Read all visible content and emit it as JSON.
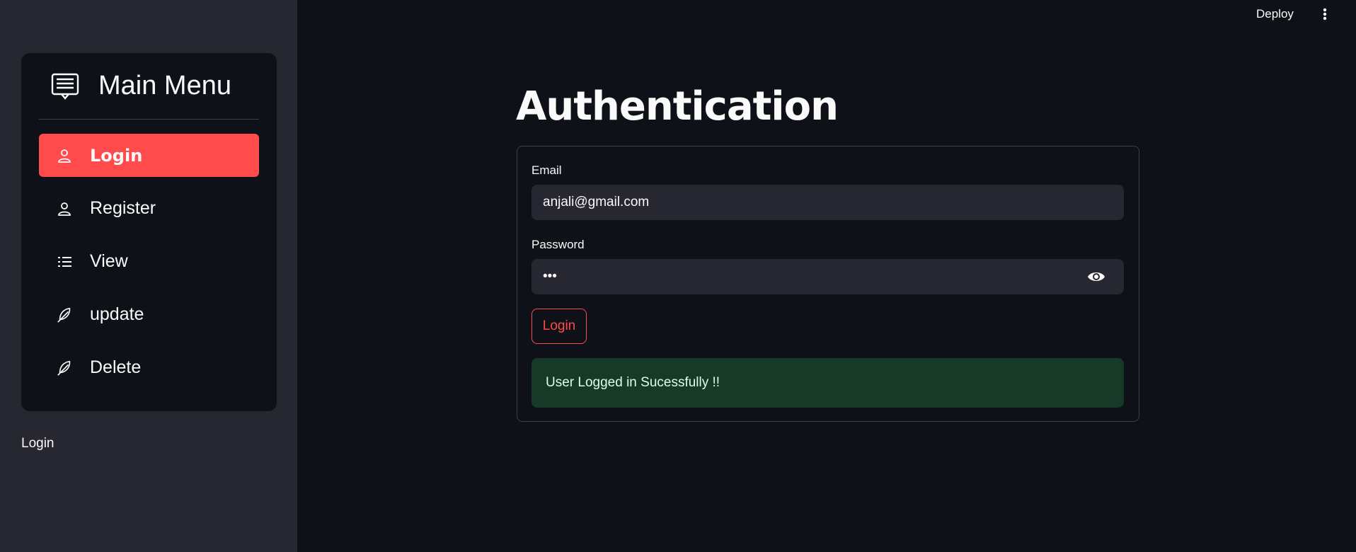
{
  "sidebar": {
    "menu_title": "Main Menu",
    "items": [
      {
        "label": "Login",
        "icon": "person-icon",
        "active": true
      },
      {
        "label": "Register",
        "icon": "person-icon",
        "active": false
      },
      {
        "label": "View",
        "icon": "list-icon",
        "active": false
      },
      {
        "label": "update",
        "icon": "feather-icon",
        "active": false
      },
      {
        "label": "Delete",
        "icon": "feather-icon",
        "active": false
      }
    ],
    "status_text": "Login"
  },
  "topbar": {
    "deploy_label": "Deploy",
    "menu_icon": "kebab-menu-icon"
  },
  "main": {
    "title": "Authentication",
    "form": {
      "email_label": "Email",
      "email_value": "anjali@gmail.com",
      "password_label": "Password",
      "password_value": "•••",
      "password_icon": "eye-icon",
      "submit_label": "Login",
      "success_message": "User Logged in Sucessfully !!"
    }
  },
  "colors": {
    "background": "#0e1117",
    "sidebar": "#262730",
    "accent": "#ff4b4b",
    "success_bg": "#173928"
  }
}
